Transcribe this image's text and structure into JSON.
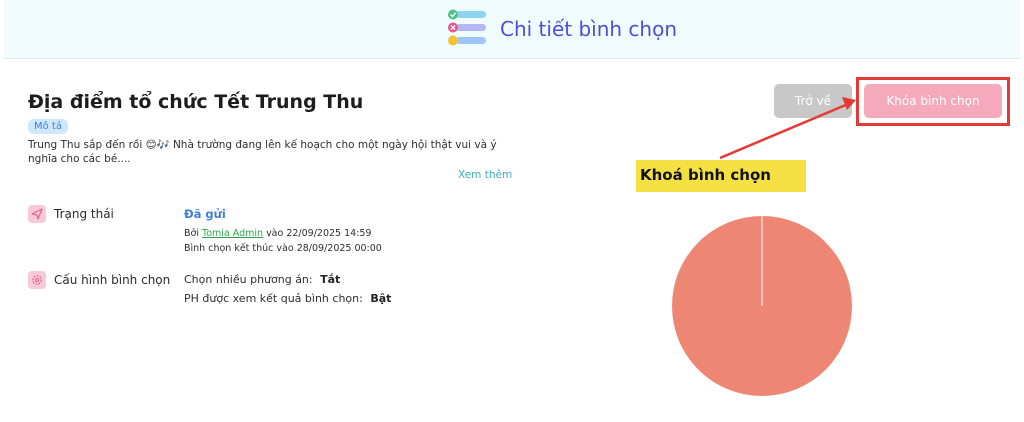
{
  "header": {
    "title": "Chi tiết bình chọn",
    "icon": "checklist-icon"
  },
  "poll": {
    "title": "Địa điểm tổ chức Tết Trung Thu",
    "description_label": "Mô tả",
    "description": "Trung Thu sắp đến rồi 😊🎶 Nhà trường đang lên kế hoạch cho một ngày hội thật vui và ý nghĩa cho các bé....",
    "see_more": "Xem thêm"
  },
  "status": {
    "label": "Trạng thái",
    "value": "Đã gửi",
    "by_prefix": "Bởi",
    "author": "Tomia Admin",
    "sent_at": "vào 22/09/2025 14:59",
    "end_text": "Bình chọn kết thúc vào 28/09/2025 00:00"
  },
  "config": {
    "label": "Cấu hình bình chọn",
    "multi_label": "Chọn nhiều phương án:",
    "multi_value": "Tắt",
    "parent_view_label": "PH được xem kết quả bình chọn:",
    "parent_view_value": "Bật"
  },
  "actions": {
    "back": "Trở về",
    "lock": "Khóa bình chọn"
  },
  "annotation": {
    "callout": "Khoá bình chọn"
  },
  "colors": {
    "accent": "#4a4fd6",
    "pie": "#ee8674",
    "lock_button": "#f4a9bd",
    "highlight": "#e53935",
    "callout": "#f5e044"
  },
  "chart_data": {
    "type": "pie",
    "values": [
      100
    ],
    "colors": [
      "#ee8674"
    ]
  }
}
